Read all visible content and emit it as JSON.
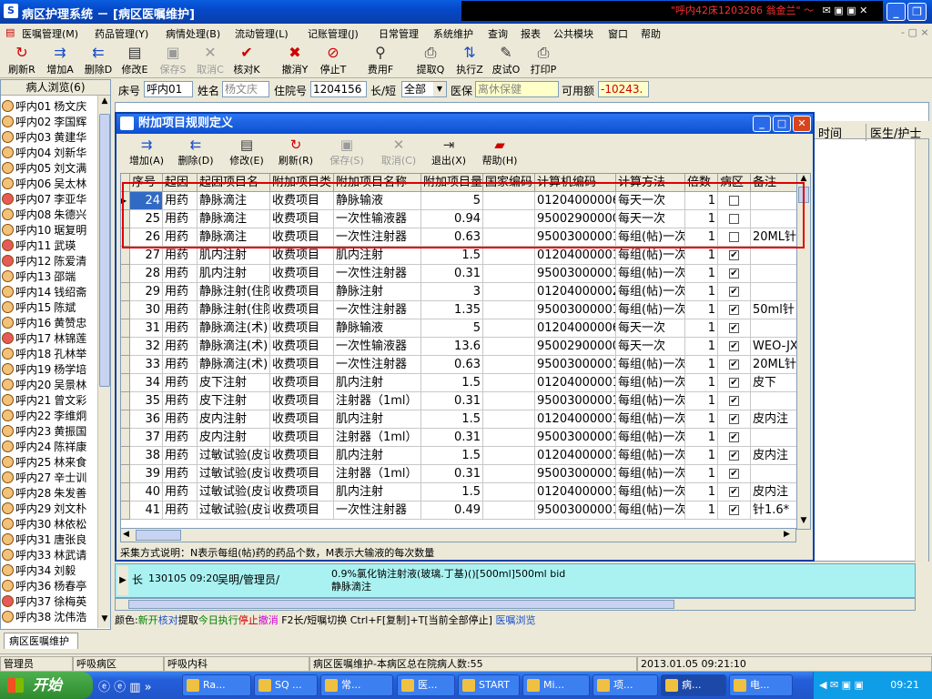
{
  "window": {
    "title": "病区护理系统 － [病区医嘱维护]",
    "alert": "\"呼内42床1203286 翁金兰\" ～"
  },
  "menu": [
    "医嘱管理(M)",
    "药品管理(Y)",
    "病情处理(B)",
    "流动管理(L)",
    "记账管理(J)",
    "日常管理",
    "系统维护",
    "查询",
    "报表",
    "公共模块",
    "窗口",
    "帮助"
  ],
  "toolbar": [
    {
      "label": "刷新R",
      "icon": "refresh-icon",
      "glyph": "↻",
      "cls": "red"
    },
    {
      "label": "增加A",
      "icon": "add-icon",
      "glyph": "⇉",
      "cls": "blue"
    },
    {
      "label": "删除D",
      "icon": "delete-icon",
      "glyph": "⇇",
      "cls": "blue"
    },
    {
      "label": "修改E",
      "icon": "edit-icon",
      "glyph": "▤",
      "cls": "dark"
    },
    {
      "label": "保存S",
      "icon": "save-icon",
      "glyph": "▣",
      "cls": "dis"
    },
    {
      "label": "取消C",
      "icon": "cancel-icon",
      "glyph": "✕",
      "cls": "dis"
    },
    {
      "label": "核对K",
      "icon": "check-icon",
      "glyph": "✔",
      "cls": "red"
    },
    {
      "label": "撤消Y",
      "icon": "undo-icon",
      "glyph": "✖",
      "cls": "red"
    },
    {
      "label": "停止T",
      "icon": "stop-icon",
      "glyph": "⊘",
      "cls": "red"
    },
    {
      "label": "费用F",
      "icon": "magnifier-icon",
      "glyph": "⚲",
      "cls": "dark"
    },
    {
      "label": "提取Q",
      "icon": "extract-icon",
      "glyph": "⎙",
      "cls": "dark"
    },
    {
      "label": "执行Z",
      "icon": "execute-icon",
      "glyph": "⇅",
      "cls": "blue"
    },
    {
      "label": "皮试O",
      "icon": "skin-test-icon",
      "glyph": "✎",
      "cls": "dark"
    },
    {
      "label": "打印P",
      "icon": "printer-icon",
      "glyph": "⎙",
      "cls": "dark"
    }
  ],
  "left_panel": {
    "header": "病人浏览(6)",
    "patients": [
      {
        "bed": "呼内01",
        "name": "杨文庆",
        "f": false
      },
      {
        "bed": "呼内02",
        "name": "李国辉",
        "f": false
      },
      {
        "bed": "呼内03",
        "name": "黄建华",
        "f": false
      },
      {
        "bed": "呼内04",
        "name": "刘新华",
        "f": false
      },
      {
        "bed": "呼内05",
        "name": "刘文满",
        "f": false
      },
      {
        "bed": "呼内06",
        "name": "吴太林",
        "f": false
      },
      {
        "bed": "呼内07",
        "name": "李亚华",
        "f": true
      },
      {
        "bed": "呼内08",
        "name": "朱德兴",
        "f": false
      },
      {
        "bed": "呼内10",
        "name": "琚复明",
        "f": false
      },
      {
        "bed": "呼内11",
        "name": "武瑛",
        "f": true
      },
      {
        "bed": "呼内12",
        "name": "陈爱清",
        "f": true
      },
      {
        "bed": "呼内13",
        "name": "邵端",
        "f": false
      },
      {
        "bed": "呼内14",
        "name": "钱绍斋",
        "f": false
      },
      {
        "bed": "呼内15",
        "name": "陈斌",
        "f": false
      },
      {
        "bed": "呼内16",
        "name": "黄赞忠",
        "f": false
      },
      {
        "bed": "呼内17",
        "name": "林锦莲",
        "f": true
      },
      {
        "bed": "呼内18",
        "name": "孔林举",
        "f": false
      },
      {
        "bed": "呼内19",
        "name": "杨学培",
        "f": false
      },
      {
        "bed": "呼内20",
        "name": "吴景林",
        "f": false
      },
      {
        "bed": "呼内21",
        "name": "曾文彩",
        "f": false
      },
      {
        "bed": "呼内22",
        "name": "李维炯",
        "f": false
      },
      {
        "bed": "呼内23",
        "name": "黄振国",
        "f": false
      },
      {
        "bed": "呼内24",
        "name": "陈祥康",
        "f": false
      },
      {
        "bed": "呼内25",
        "name": "林来食",
        "f": false
      },
      {
        "bed": "呼内27",
        "name": "辛士训",
        "f": false
      },
      {
        "bed": "呼内28",
        "name": "朱发善",
        "f": false
      },
      {
        "bed": "呼内29",
        "name": "刘文朴",
        "f": false
      },
      {
        "bed": "呼内30",
        "name": "林依松",
        "f": false
      },
      {
        "bed": "呼内31",
        "name": "唐张良",
        "f": false
      },
      {
        "bed": "呼内33",
        "name": "林武请",
        "f": false
      },
      {
        "bed": "呼内34",
        "name": "刘毅",
        "f": false
      },
      {
        "bed": "呼内36",
        "name": "杨春亭",
        "f": false
      },
      {
        "bed": "呼内37",
        "name": "徐梅英",
        "f": true
      },
      {
        "bed": "呼内38",
        "name": "沈伟浩",
        "f": false
      }
    ]
  },
  "header": {
    "bed_label": "床号",
    "bed_value": "呼内01",
    "name_label": "姓名",
    "name_value": "杨文庆",
    "inpatient_label": "住院号",
    "inpatient_value": "1204156",
    "term_label": "长/短",
    "term_value": "全部",
    "insurance_label": "医保",
    "insurance_value": "离休保健",
    "balance_label": "可用额",
    "balance_value": "-10243."
  },
  "behind_columns": [
    "时间",
    "医生/护士"
  ],
  "dialog": {
    "title": "附加项目规则定义",
    "toolbar": [
      {
        "label": "增加(A)",
        "icon": "add-icon",
        "glyph": "⇉",
        "cls": "blue"
      },
      {
        "label": "删除(D)",
        "icon": "delete-icon",
        "glyph": "⇇",
        "cls": "blue"
      },
      {
        "label": "修改(E)",
        "icon": "edit-icon",
        "glyph": "▤",
        "cls": "dark"
      },
      {
        "label": "刷新(R)",
        "icon": "refresh-icon",
        "glyph": "↻",
        "cls": "red"
      },
      {
        "label": "保存(S)",
        "icon": "save-icon",
        "glyph": "▣",
        "cls": "dis"
      },
      {
        "label": "取消(C)",
        "icon": "cancel-icon",
        "glyph": "✕",
        "cls": "dis"
      },
      {
        "label": "退出(X)",
        "icon": "exit-icon",
        "glyph": "⇥",
        "cls": "dark"
      },
      {
        "label": "帮助(H)",
        "icon": "help-book-icon",
        "glyph": "▰",
        "cls": "red"
      }
    ],
    "columns": [
      "序号",
      "起因",
      "起因项目名",
      "附加项目类",
      "附加项目名称",
      "附加项目量",
      "国家编码",
      "计算机编码",
      "计算方法",
      "倍数",
      "病区",
      "备注"
    ],
    "rows": [
      [
        "24",
        "用药",
        "静脉滴注",
        "收费项目",
        "静脉输液",
        "5",
        "",
        "012040000060",
        "每天一次",
        "1",
        false,
        ""
      ],
      [
        "25",
        "用药",
        "静脉滴注",
        "收费项目",
        "一次性输液器",
        "0.94",
        "",
        "950029000001",
        "每天一次",
        "1",
        false,
        ""
      ],
      [
        "26",
        "用药",
        "静脉滴注",
        "收费项目",
        "一次性注射器",
        "0.63",
        "",
        "950030000010",
        "每组(帖)一次",
        "1",
        false,
        "20ML针"
      ],
      [
        "27",
        "用药",
        "肌内注射",
        "收费项目",
        "肌内注射",
        "1.5",
        "",
        "012040000010",
        "每组(帖)一次",
        "1",
        true,
        ""
      ],
      [
        "28",
        "用药",
        "肌内注射",
        "收费项目",
        "一次性注射器",
        "0.31",
        "",
        "950030000010",
        "每组(帖)一次",
        "1",
        true,
        ""
      ],
      [
        "29",
        "用药",
        "静脉注射(住院)",
        "收费项目",
        "静脉注射",
        "3",
        "",
        "012040000020",
        "每组(帖)一次",
        "1",
        true,
        ""
      ],
      [
        "30",
        "用药",
        "静脉注射(住院)",
        "收费项目",
        "一次性注射器",
        "1.35",
        "",
        "950030000010",
        "每组(帖)一次",
        "1",
        true,
        "50ml针"
      ],
      [
        "31",
        "用药",
        "静脉滴注(术)",
        "收费项目",
        "静脉输液",
        "5",
        "",
        "012040000060",
        "每天一次",
        "1",
        true,
        ""
      ],
      [
        "32",
        "用药",
        "静脉滴注(术)",
        "收费项目",
        "一次性输液器",
        "13.6",
        "",
        "950029000001",
        "每天一次",
        "1",
        true,
        "WEO-JX"
      ],
      [
        "33",
        "用药",
        "静脉滴注(术)",
        "收费项目",
        "一次性注射器",
        "0.63",
        "",
        "950030000010",
        "每组(帖)一次",
        "1",
        true,
        "20ML针"
      ],
      [
        "34",
        "用药",
        "皮下注射",
        "收费项目",
        "肌内注射",
        "1.5",
        "",
        "012040000010",
        "每组(帖)一次",
        "1",
        true,
        "皮下"
      ],
      [
        "35",
        "用药",
        "皮下注射",
        "收费项目",
        "注射器（1ml）",
        "0.31",
        "",
        "950030000010",
        "每组(帖)一次",
        "1",
        true,
        ""
      ],
      [
        "36",
        "用药",
        "皮内注射",
        "收费项目",
        "肌内注射",
        "1.5",
        "",
        "012040000010",
        "每组(帖)一次",
        "1",
        true,
        "皮内注"
      ],
      [
        "37",
        "用药",
        "皮内注射",
        "收费项目",
        "注射器（1ml）",
        "0.31",
        "",
        "950030000010",
        "每组(帖)一次",
        "1",
        true,
        ""
      ],
      [
        "38",
        "用药",
        "过敏试验(皮试)",
        "收费项目",
        "肌内注射",
        "1.5",
        "",
        "012040000010",
        "每组(帖)一次",
        "1",
        true,
        "皮内注"
      ],
      [
        "39",
        "用药",
        "过敏试验(皮试)",
        "收费项目",
        "注射器（1ml）",
        "0.31",
        "",
        "950030000010",
        "每组(帖)一次",
        "1",
        true,
        ""
      ],
      [
        "40",
        "用药",
        "过敏试验(皮试)",
        "收费项目",
        "肌内注射",
        "1.5",
        "",
        "012040000010",
        "每组(帖)一次",
        "1",
        true,
        "皮内注"
      ],
      [
        "41",
        "用药",
        "过敏试验(皮试)",
        "收费项目",
        "一次性注射器",
        "0.49",
        "",
        "950030000010",
        "每组(帖)一次",
        "1",
        true,
        "针1.6*"
      ]
    ],
    "footnote": "采集方式说明：N表示每组(帖)药的药品个数，M表示大输液的每次数量"
  },
  "bottom_info": {
    "term": "长",
    "time": "130105 09:20",
    "staff": "吴明/管理员/",
    "drug": "0.9%氯化钠注射液(玻璃.丁基)()[500ml]500ml bid",
    "route": "静脉滴注"
  },
  "legend": [
    {
      "text": "颜色:",
      "color": "#000000"
    },
    {
      "text": "新开",
      "color": "#008000"
    },
    {
      "text": "核对",
      "color": "#1a4fc8"
    },
    {
      "text": "提取",
      "color": "#000000"
    },
    {
      "text": "今日执行",
      "color": "#008000"
    },
    {
      "text": "停止",
      "color": "#d00000"
    },
    {
      "text": "撤消",
      "color": "#d000d0"
    },
    {
      "text": " F2长/短嘱切换  Ctrl+F[复制]+T[当前全部停止] ",
      "color": "#000000"
    },
    {
      "text": "医嘱浏览",
      "color": "#1a4fc8"
    }
  ],
  "tab": "病区医嘱维护",
  "status": [
    "管理员",
    "呼吸病区",
    "呼吸内科",
    "病区医嘱维护-本病区总在院病人数:55",
    "2013.01.05 09:21:10"
  ],
  "taskbar": {
    "start": "开始",
    "tasks": [
      "Ra...",
      "SQ ...",
      "常...",
      "医...",
      "START",
      "Mi...",
      "项...",
      "病...",
      "电..."
    ],
    "clock": "09:21"
  }
}
